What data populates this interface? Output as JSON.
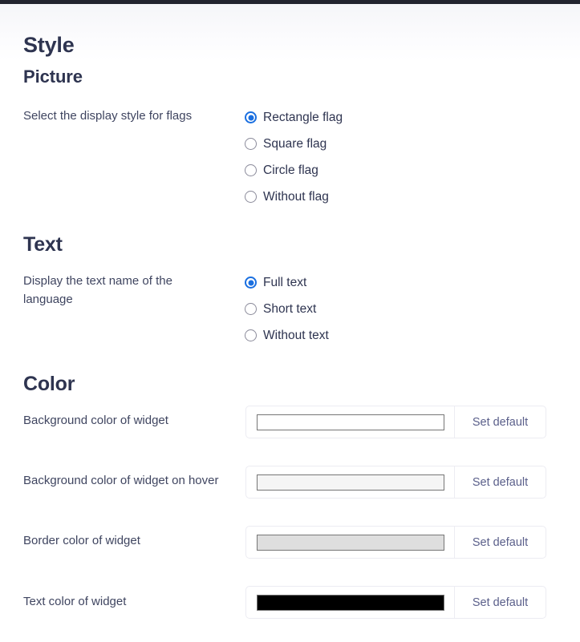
{
  "page": {
    "title": "Style",
    "subtitle": "Picture"
  },
  "theme": {
    "top_bar_color": "#22242f",
    "heading_color": "#2e3450",
    "label_color": "#3f4560",
    "accent_color": "#1a6fe0",
    "button_text_color": "#5a5f8a",
    "container_border_color": "#ececf2"
  },
  "picture_section": {
    "label": "Select the display style for flags",
    "options": [
      {
        "label": "Rectangle flag",
        "selected": true
      },
      {
        "label": "Square flag",
        "selected": false
      },
      {
        "label": "Circle flag",
        "selected": false
      },
      {
        "label": "Without flag",
        "selected": false
      }
    ]
  },
  "text_section": {
    "heading": "Text",
    "label": "Display the text name of the language",
    "options": [
      {
        "label": "Full text",
        "selected": true
      },
      {
        "label": "Short text",
        "selected": false
      },
      {
        "label": "Without text",
        "selected": false
      }
    ]
  },
  "color_section": {
    "heading": "Color",
    "set_default_label": "Set default",
    "rows": [
      {
        "label": "Background color of widget",
        "swatch_color": "#ffffff"
      },
      {
        "label": "Background color of widget on hover",
        "swatch_color": "#f5f5f5"
      },
      {
        "label": "Border color of widget",
        "swatch_color": "#dedede"
      },
      {
        "label": "Text color of widget",
        "swatch_color": "#000000"
      }
    ]
  }
}
